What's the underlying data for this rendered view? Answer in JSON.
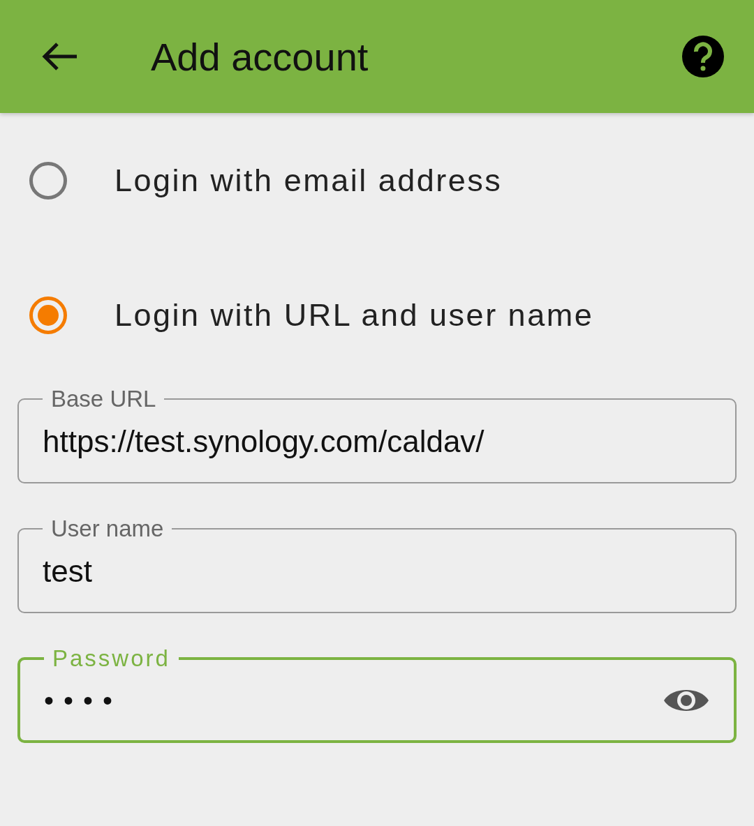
{
  "app_bar": {
    "title": "Add account"
  },
  "options": [
    {
      "label": "Login with email address",
      "selected": false
    },
    {
      "label": "Login with URL and user name",
      "selected": true
    }
  ],
  "fields": [
    {
      "kind": "text",
      "label": "Base URL",
      "value": "https://test.synology.com/caldav/",
      "focused": false
    },
    {
      "kind": "text",
      "label": "User name",
      "value": "test",
      "focused": false
    },
    {
      "kind": "password",
      "label": "Password",
      "value": "••••",
      "focused": true
    }
  ]
}
